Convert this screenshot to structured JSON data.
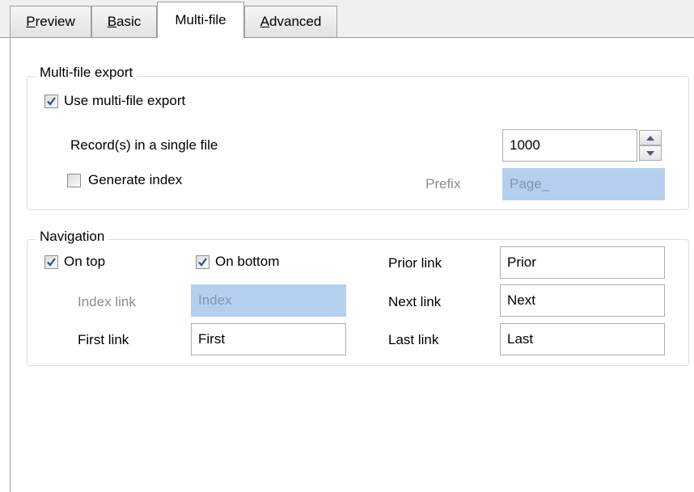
{
  "tabs": [
    {
      "label": "Preview",
      "underline": "P",
      "rest": "review"
    },
    {
      "label": "Basic",
      "underline": "B",
      "rest": "asic"
    },
    {
      "label": "Multi-file"
    },
    {
      "label": "Advanced",
      "underline": "A",
      "rest": "dvanced"
    }
  ],
  "active_tab": "Multi-file",
  "multi_file_export": {
    "legend": "Multi-file export",
    "use_multi_file": {
      "label": "Use multi-file export",
      "checked": true
    },
    "records_label": "Record(s) in a single file",
    "records_value": "1000",
    "generate_index": {
      "label": "Generate index",
      "checked": false
    },
    "prefix_label": "Prefix",
    "prefix_value": "Page_"
  },
  "navigation": {
    "legend": "Navigation",
    "on_top": {
      "label": "On top",
      "checked": true
    },
    "on_bottom": {
      "label": "On bottom",
      "checked": true
    },
    "index_link_label": "Index link",
    "index_link_value": "Index",
    "first_link_label": "First link",
    "first_link_value": "First",
    "prior_link_label": "Prior link",
    "prior_link_value": "Prior",
    "next_link_label": "Next link",
    "next_link_value": "Next",
    "last_link_label": "Last link",
    "last_link_value": "Last"
  },
  "colors": {
    "disabled_field": "#b5cfef",
    "group_border": "#d5dfe5",
    "check_mark": "#2d4f94"
  }
}
